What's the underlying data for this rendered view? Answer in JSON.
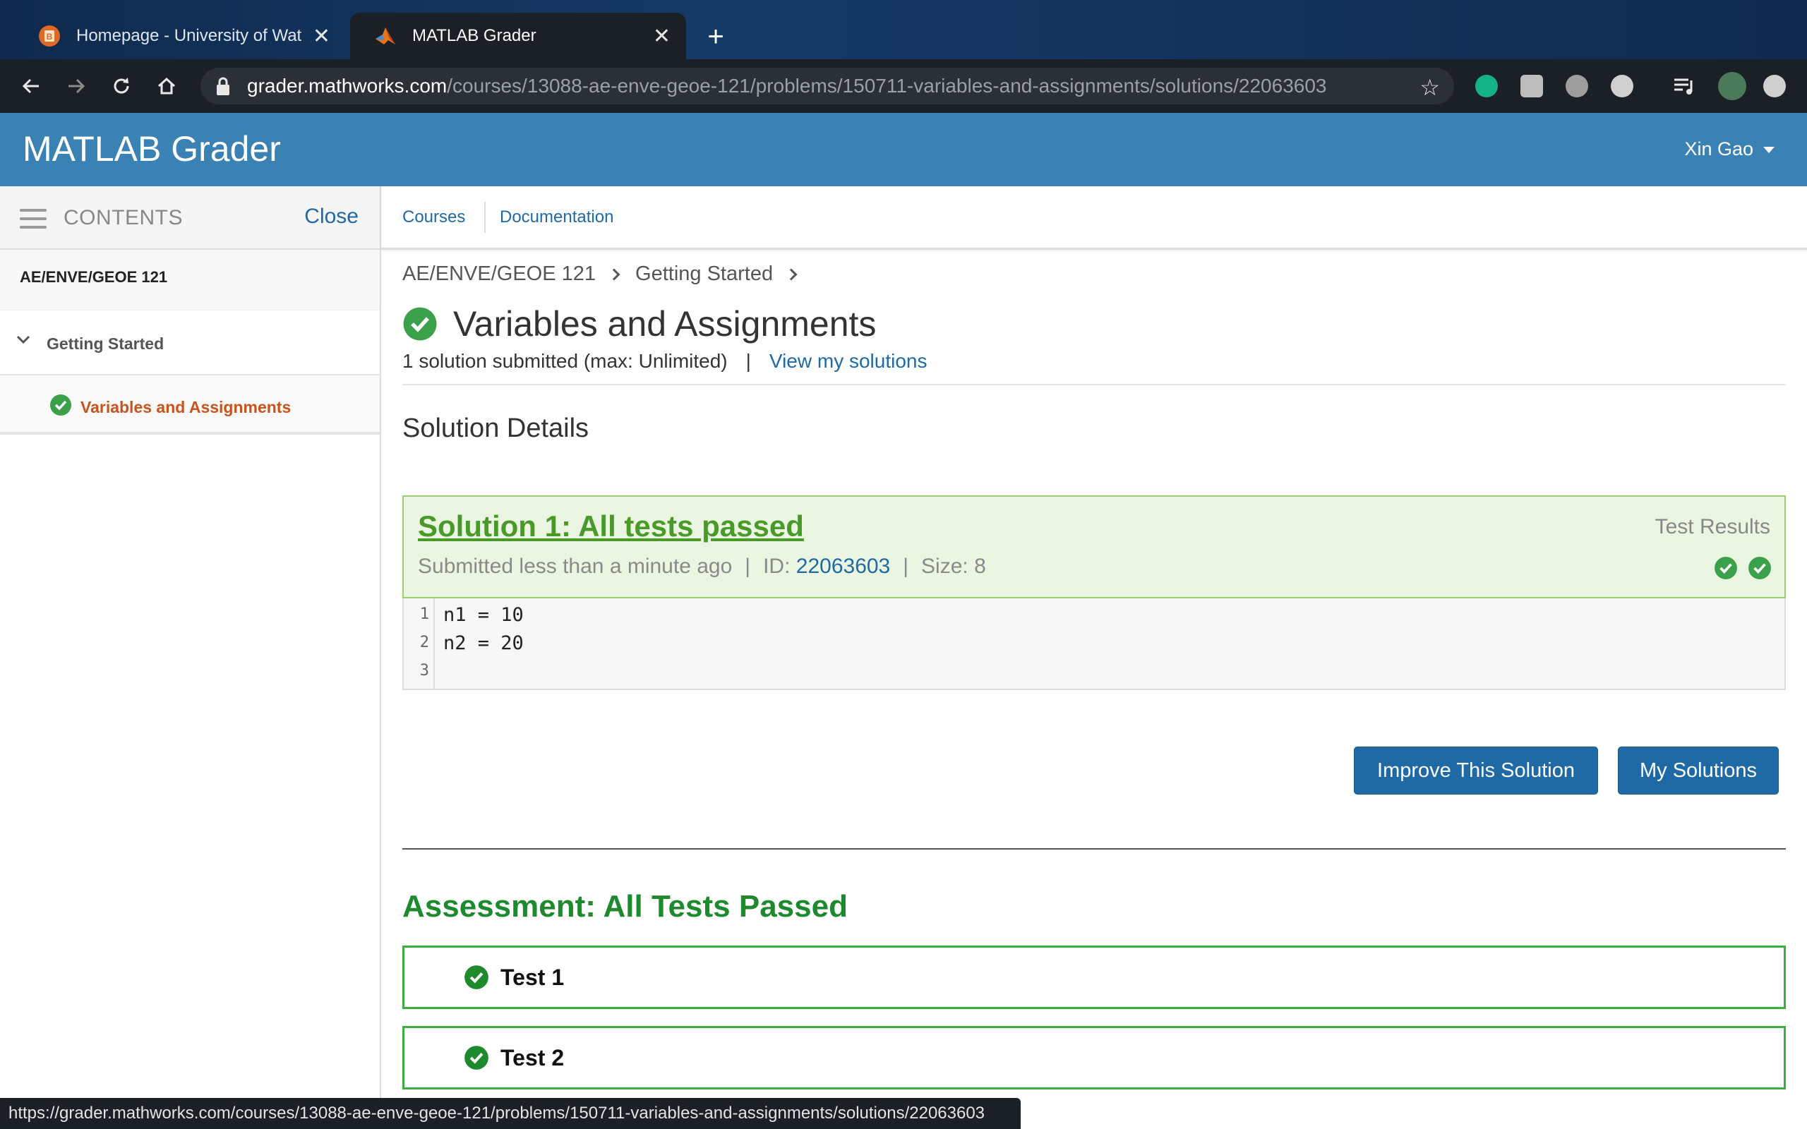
{
  "browser": {
    "tabs": [
      {
        "title": "Homepage - University of Waterloo",
        "active": false
      },
      {
        "title": "MATLAB Grader",
        "active": true
      }
    ],
    "url_host": "grader.mathworks.com",
    "url_path": "/courses/13088-ae-enve-geoe-121/problems/150711-variables-and-assignments/solutions/22063603",
    "status_url": "https://grader.mathworks.com/courses/13088-ae-enve-geoe-121/problems/150711-variables-and-assignments/solutions/22063603",
    "colors": {
      "tabbar": "#0f2a4e",
      "toolbar": "#1b1f26"
    }
  },
  "header": {
    "brand": "MATLAB Grader",
    "user": "Xin Gao",
    "color": "#3b82b4"
  },
  "sidebar": {
    "heading": "CONTENTS",
    "close_label": "Close",
    "course": "AE/ENVE/GEOE 121",
    "section": "Getting Started",
    "item": "Variables and Assignments"
  },
  "nav": {
    "courses": "Courses",
    "documentation": "Documentation"
  },
  "breadcrumb": [
    "AE/ENVE/GEOE 121",
    "Getting Started"
  ],
  "problem": {
    "title": "Variables and Assignments",
    "submitted": "1 solution submitted (max: Unlimited)",
    "pipe": "|",
    "view_link": "View my solutions"
  },
  "solution": {
    "section_heading": "Solution Details",
    "title": "Solution 1: All tests passed",
    "submitted_text": "Submitted less than a minute ago",
    "id_label": "ID:",
    "id": "22063603",
    "size": "Size: 8",
    "test_results_label": "Test Results",
    "code_lines": [
      {
        "n": "1",
        "text": "n1 = 10"
      },
      {
        "n": "2",
        "text": "n2 = 20"
      },
      {
        "n": "3",
        "text": ""
      }
    ]
  },
  "buttons": {
    "improve": "Improve This Solution",
    "my_solutions": "My Solutions"
  },
  "assessment": {
    "heading": "Assessment: All Tests Passed",
    "tests": [
      "Test 1",
      "Test 2"
    ]
  },
  "colors": {
    "pass_green": "#3aa14a",
    "link_blue": "#1f6aa5",
    "accent_orange": "#c8531e"
  }
}
